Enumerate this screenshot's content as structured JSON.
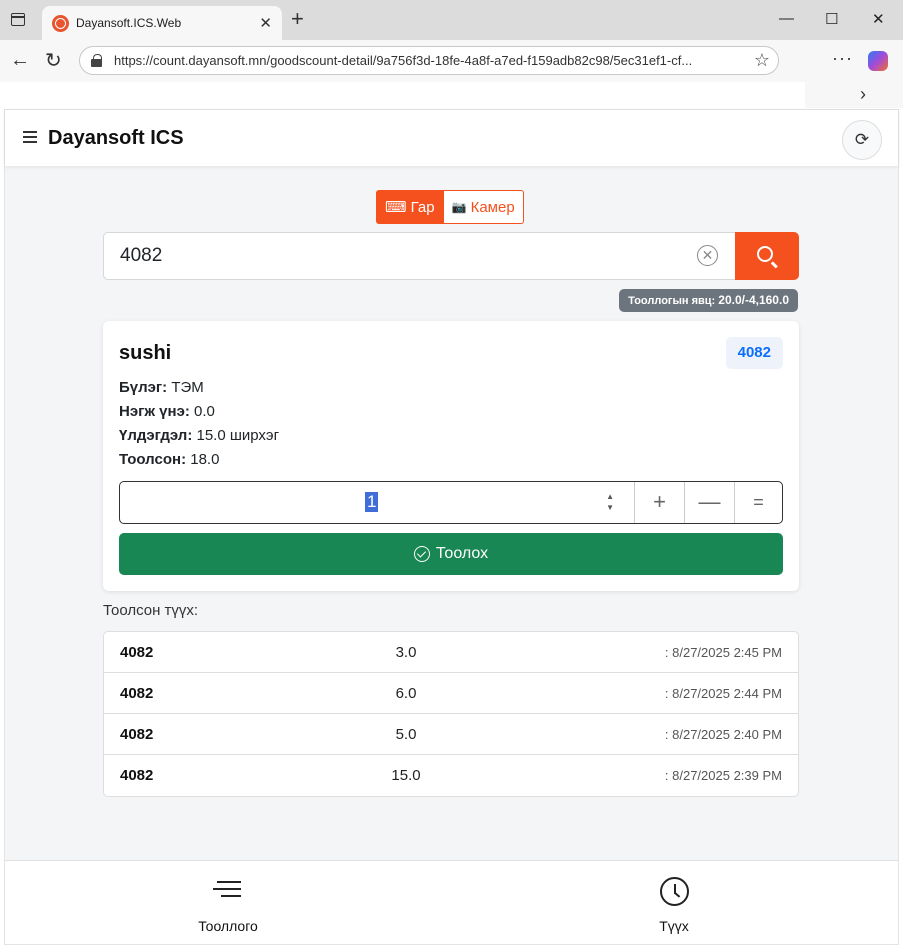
{
  "browser": {
    "tab_title": "Dayansoft.ICS.Web",
    "tab_close": "✕",
    "new_tab": "+",
    "minimize": "—",
    "maximize": "☐",
    "close": "✕",
    "url": "https://count.dayansoft.mn/goodscount-detail/9a756f3d-18fe-4a8f-a7ed-f159adb82c98/5ec31ef1-cf...",
    "back": "←",
    "reload": "↻",
    "star": "☆",
    "more": "···",
    "chevron": "›"
  },
  "app": {
    "title": "Dayansoft ICS",
    "refresh_glyph": "⟳"
  },
  "mode": {
    "keyboard_label": "Гар",
    "keyboard_glyph": "⌨",
    "camera_label": "Камер",
    "camera_glyph": "📷"
  },
  "search": {
    "value": "4082",
    "clear_glyph": "✕"
  },
  "progress": {
    "label": "Тооллогын явц:",
    "value": "20.0/-4,160.0"
  },
  "product": {
    "name": "sushi",
    "code": "4082",
    "group_label": "Бүлэг:",
    "group_value": "ТЭМ",
    "price_label": "Нэгж үнэ:",
    "price_value": "0.0",
    "stock_label": "Үлдэгдэл:",
    "stock_value": "15.0 ширхэг",
    "counted_label": "Тоолсон:",
    "counted_value": "18.0"
  },
  "quantity": {
    "value": "1",
    "spin_up": "▲",
    "spin_down": "▼",
    "plus": "+",
    "minus": "—",
    "equals": "="
  },
  "count_button": {
    "label": "Тоолох"
  },
  "history": {
    "title": "Тоолсон түүх:",
    "rows": [
      {
        "code": "4082",
        "qty": "3.0",
        "time": ": 8/27/2025 2:45 PM"
      },
      {
        "code": "4082",
        "qty": "6.0",
        "time": ": 8/27/2025 2:44 PM"
      },
      {
        "code": "4082",
        "qty": "5.0",
        "time": ": 8/27/2025 2:40 PM"
      },
      {
        "code": "4082",
        "qty": "15.0",
        "time": ": 8/27/2025 2:39 PM"
      }
    ]
  },
  "bottom_nav": {
    "count_label": "Тооллого",
    "history_label": "Түүх"
  },
  "colors": {
    "accent": "#f4511e",
    "success": "#198754",
    "link": "#0d6efd"
  }
}
